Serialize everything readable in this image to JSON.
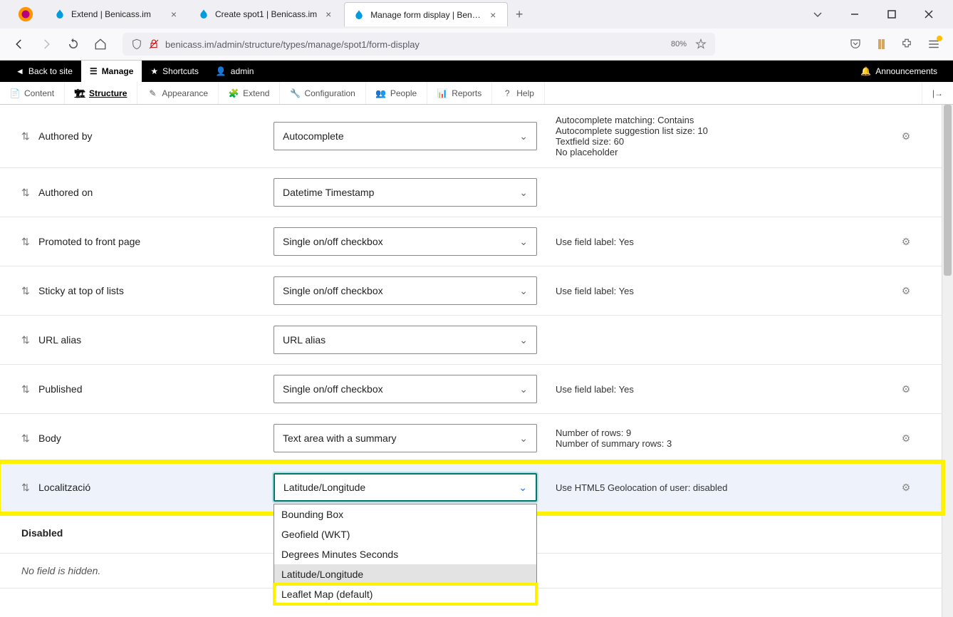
{
  "browser": {
    "tabs": [
      {
        "title": "Extend | Benicass.im",
        "active": false
      },
      {
        "title": "Create spot1 | Benicass.im",
        "active": false
      },
      {
        "title": "Manage form display | Benicass…",
        "active": true
      }
    ],
    "url": "benicass.im/admin/structure/types/manage/spot1/form-display",
    "zoom": "80%"
  },
  "topbar": {
    "back_to_site": "Back to site",
    "manage": "Manage",
    "shortcuts": "Shortcuts",
    "admin": "admin",
    "announcements": "Announcements"
  },
  "menubar": {
    "content": "Content",
    "structure": "Structure",
    "appearance": "Appearance",
    "extend": "Extend",
    "configuration": "Configuration",
    "people": "People",
    "reports": "Reports",
    "help": "Help"
  },
  "rows": {
    "authored_by": {
      "label": "Authored by",
      "widget": "Autocomplete",
      "summary": {
        "l1": "Autocomplete matching: Contains",
        "l2": "Autocomplete suggestion list size: 10",
        "l3": "Textfield size: 60",
        "l4": "No placeholder"
      }
    },
    "authored_on": {
      "label": "Authored on",
      "widget": "Datetime Timestamp"
    },
    "promoted": {
      "label": "Promoted to front page",
      "widget": "Single on/off checkbox",
      "summary": "Use field label: Yes"
    },
    "sticky": {
      "label": "Sticky at top of lists",
      "widget": "Single on/off checkbox",
      "summary": "Use field label: Yes"
    },
    "url_alias": {
      "label": "URL alias",
      "widget": "URL alias"
    },
    "published": {
      "label": "Published",
      "widget": "Single on/off checkbox",
      "summary": "Use field label: Yes"
    },
    "body": {
      "label": "Body",
      "widget": "Text area with a summary",
      "summary": {
        "l1": "Number of rows: 9",
        "l2": "Number of summary rows: 3"
      }
    },
    "localitzacio": {
      "label": "Localització",
      "widget": "Latitude/Longitude",
      "summary": "Use HTML5 Geolocation of user: disabled",
      "options": {
        "o0": "Bounding Box",
        "o1": "Geofield (WKT)",
        "o2": "Degrees Minutes Seconds",
        "o3": "Latitude/Longitude",
        "o4": "Leaflet Map (default)"
      }
    }
  },
  "disabled_section": {
    "title": "Disabled",
    "empty": "No field is hidden."
  }
}
